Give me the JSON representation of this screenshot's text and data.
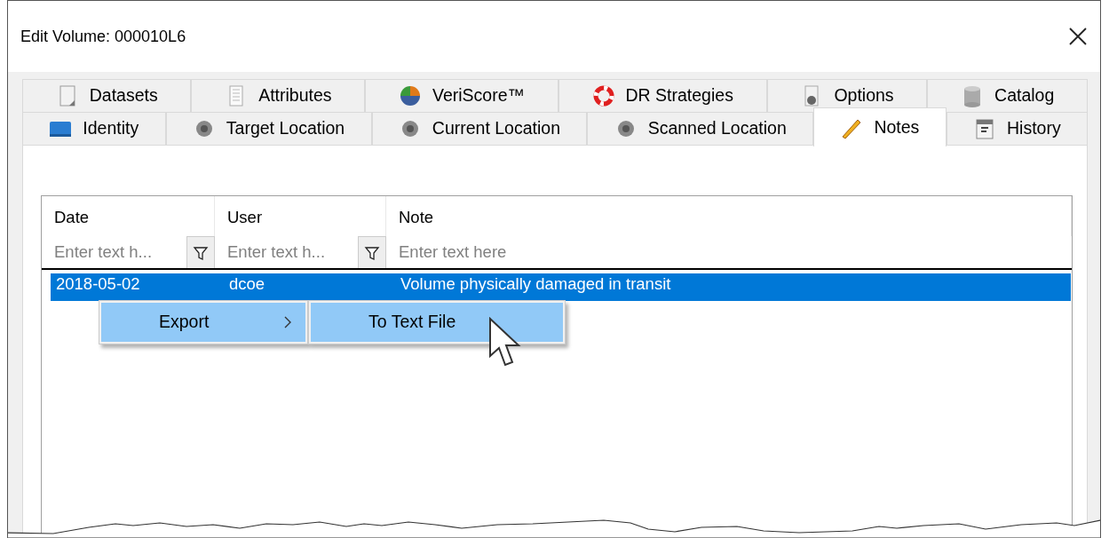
{
  "window": {
    "title": "Edit Volume: 000010L6"
  },
  "tab_rows": [
    [
      {
        "label": "Datasets",
        "selected": false
      },
      {
        "label": "Attributes",
        "selected": false
      },
      {
        "label": "VeriScore™",
        "selected": false
      },
      {
        "label": "DR Strategies",
        "selected": false
      },
      {
        "label": "Options",
        "selected": false
      },
      {
        "label": "Catalog",
        "selected": false
      }
    ],
    [
      {
        "label": "Identity",
        "selected": false
      },
      {
        "label": "Target Location",
        "selected": false
      },
      {
        "label": "Current Location",
        "selected": false
      },
      {
        "label": "Scanned Location",
        "selected": false
      },
      {
        "label": "Notes",
        "selected": true
      },
      {
        "label": "History",
        "selected": false
      }
    ]
  ],
  "grid": {
    "columns": [
      {
        "header": "Date",
        "placeholder": "Enter text h...",
        "filter_button": true
      },
      {
        "header": "User",
        "placeholder": "Enter text h...",
        "filter_button": true
      },
      {
        "header": "Note",
        "placeholder": "Enter text here",
        "filter_button": false
      }
    ],
    "rows": [
      {
        "cells": [
          "2018-05-02",
          "dcoe",
          "Volume physically damaged in transit"
        ],
        "selected": true
      }
    ]
  },
  "context_menu": {
    "items": [
      {
        "label": "Export",
        "submenu": true,
        "selected": true
      }
    ]
  },
  "submenu": {
    "items": [
      {
        "label": "To Text File",
        "submenu": false,
        "selected": true
      }
    ]
  }
}
